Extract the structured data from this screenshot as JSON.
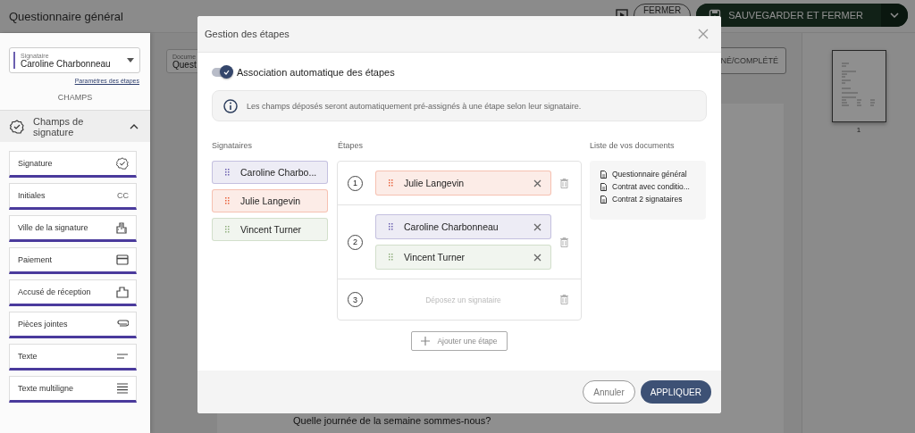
{
  "header": {
    "title": "Questionnaire général",
    "close_button": "FERMER",
    "save_button": "SAUVEGARDER ET FERMER"
  },
  "sidebar": {
    "signer_select": {
      "label": "Signataire",
      "value": "Caroline Charbonneau",
      "color": "#6b5fb0"
    },
    "steps_link": "Paramètres des étapes",
    "section_title": "CHAMPS",
    "group": {
      "title": "Champs de signature",
      "expanded": true
    },
    "fields": [
      {
        "label": "Signature",
        "kind": "signature"
      },
      {
        "label": "Initiales",
        "kind": "initials",
        "code": "CC"
      },
      {
        "label": "Ville de la signature",
        "kind": "city"
      },
      {
        "label": "Paiement",
        "kind": "payment"
      },
      {
        "label": "Accusé de réception",
        "kind": "receipt"
      },
      {
        "label": "Pièces jointes",
        "kind": "attachment"
      },
      {
        "label": "Texte",
        "kind": "text"
      },
      {
        "label": "Texte multiligne",
        "kind": "multiline"
      }
    ]
  },
  "document": {
    "select": {
      "label": "Docume",
      "value": "Quest"
    },
    "status_button": "NÉ/COMPLÉTÉ",
    "question": "Quelle journée de la semaine sommes-nous?"
  },
  "thumbnail": {
    "page": "1"
  },
  "modal": {
    "title": "Gestion des étapes",
    "auto_toggle": {
      "label": "Association automatique des étapes",
      "on": true
    },
    "info": "Les champs déposés seront automatiquement pré-assignés à une étape selon leur signataire.",
    "signers_heading": "Signataires",
    "signers": [
      {
        "name": "Caroline Charbo...",
        "color": "#6b5fb0"
      },
      {
        "name": "Julie Langevin",
        "color": "#e8623c"
      },
      {
        "name": "Vincent Turner",
        "color": "#8fae7c"
      }
    ],
    "steps_heading": "Étapes",
    "steps": [
      {
        "number": "1",
        "signers": [
          {
            "name": "Julie Langevin",
            "color": "#e8623c"
          }
        ]
      },
      {
        "number": "2",
        "signers": [
          {
            "name": "Caroline Charbonneau",
            "color": "#6b5fb0"
          },
          {
            "name": "Vincent Turner",
            "color": "#8fae7c"
          }
        ]
      },
      {
        "number": "3",
        "drop_hint": "Déposez un signataire"
      }
    ],
    "add_step_button": "Ajouter une étape",
    "documents_heading": "Liste de vos documents",
    "documents": [
      "Questionnaire général",
      "Contrat avec conditio...",
      "Contrat 2 signataires"
    ],
    "cancel_button": "Annuler",
    "apply_button": "APPLIQUER"
  }
}
